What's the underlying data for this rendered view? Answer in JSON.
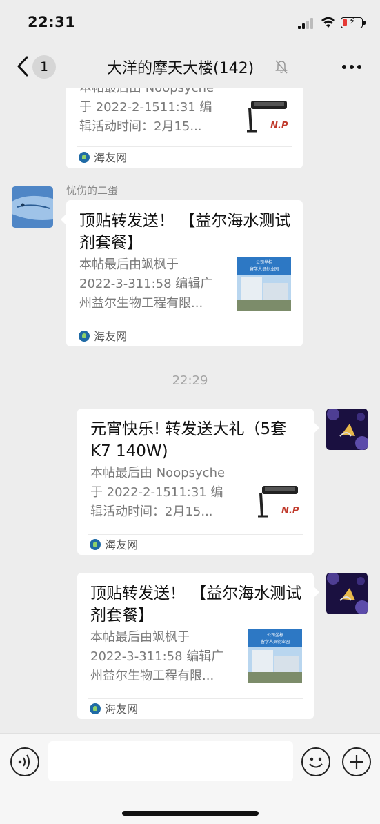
{
  "status_bar": {
    "time": "22:31"
  },
  "nav": {
    "back_count": "1",
    "title": "大洋的摩天大楼(142)"
  },
  "messages": [
    {
      "side": "left",
      "title": "",
      "desc_lines": [
        "本帖最后由 Noopsyche",
        "于 2022-2-1511:31 编",
        "辑活动时间：2月15..."
      ],
      "source": "海友网",
      "thumb": "lamp-thumbnail"
    },
    {
      "side": "left",
      "sender": "忧伤的二蛋",
      "title": "顶贴转发送！ 【益尔海水测试剂套餐】",
      "desc_lines": [
        "本帖最后由飒枫于",
        "2022-3-311:58 编辑广",
        "州益尔生物工程有限..."
      ],
      "source": "海友网",
      "thumb": "building-thumbnail"
    },
    {
      "timestamp": "22:29"
    },
    {
      "side": "right",
      "title": "元宵快乐! 转发送大礼（5套 K7  140W)",
      "desc_lines": [
        "本帖最后由 Noopsyche",
        "于 2022-2-1511:31 编",
        "辑活动时间：2月15..."
      ],
      "source": "海友网",
      "thumb": "lamp-thumbnail"
    },
    {
      "side": "right",
      "title": "顶贴转发送！ 【益尔海水测试剂套餐】",
      "desc_lines": [
        "本帖最后由飒枫于",
        "2022-3-311:58 编辑广",
        "州益尔生物工程有限..."
      ],
      "source": "海友网",
      "thumb": "building-thumbnail"
    }
  ],
  "thumb_text": {
    "lamp_brand": "N.P",
    "building_banner_1": "公司坐标",
    "building_banner_2": "留学人员创业园"
  },
  "input": {
    "placeholder": ""
  },
  "colors": {
    "background": "#ededed",
    "bubble": "#ffffff",
    "source_icon": "#1f6aa5"
  }
}
